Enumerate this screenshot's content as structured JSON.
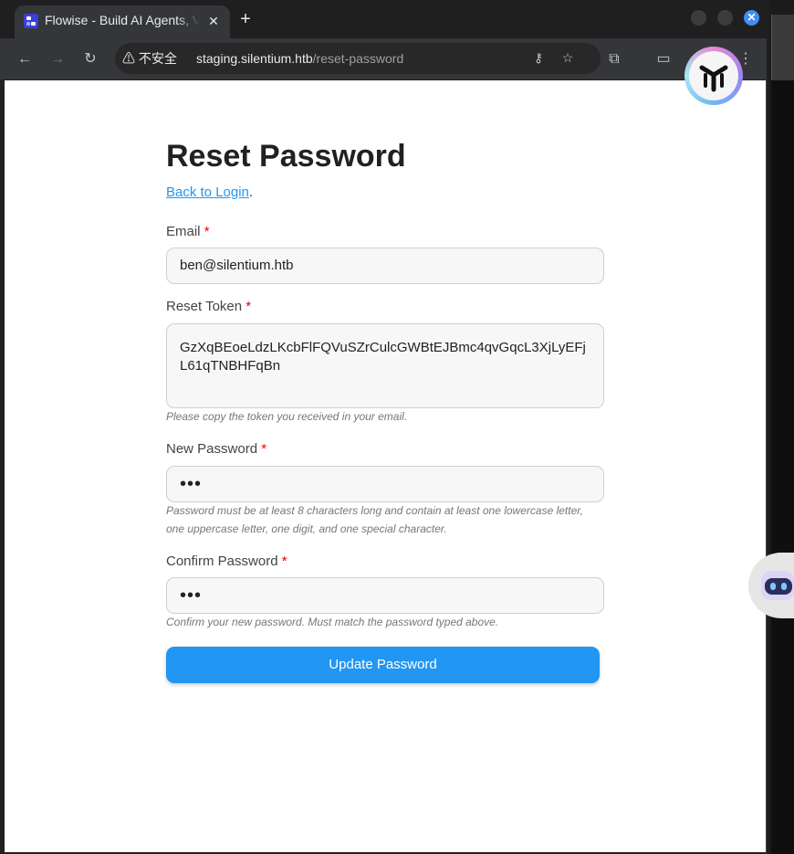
{
  "browser": {
    "tab_title": "Flowise - Build AI Agents, Visually",
    "security_label": "不安全",
    "url_host": "staging.silentium.htb",
    "url_path": "/reset-password"
  },
  "icons": {
    "back": "arrow-left-icon",
    "forward": "arrow-right-icon",
    "reload": "reload-icon",
    "key": "key-icon",
    "star": "star-icon",
    "extensions": "puzzle-icon",
    "menu": "kebab-menu-icon"
  },
  "page": {
    "title": "Reset Password",
    "back_link": "Back to Login",
    "back_suffix": ".",
    "email_label": "Email",
    "email_value": "ben@silentium.htb",
    "token_label": "Reset Token",
    "token_value": "GzXqBEoeLdzLKcbFlFQVuSZrCulcGWBtEJBmc4qvGqcL3XjLyEFjL61qTNBHFqBn",
    "token_help": "Please copy the token you received in your email.",
    "new_password_label": "New Password",
    "new_password_value": "•••",
    "new_password_help": "Password must be at least 8 characters long and contain at least one lowercase letter, one uppercase letter, one digit, and one special character.",
    "confirm_password_label": "Confirm Password",
    "confirm_password_value": "•••",
    "confirm_password_help": "Confirm your new password. Must match the password typed above.",
    "required_mark": "*",
    "submit_label": "Update Password"
  },
  "colors": {
    "accent": "#2196f3",
    "required": "#ee0000"
  }
}
